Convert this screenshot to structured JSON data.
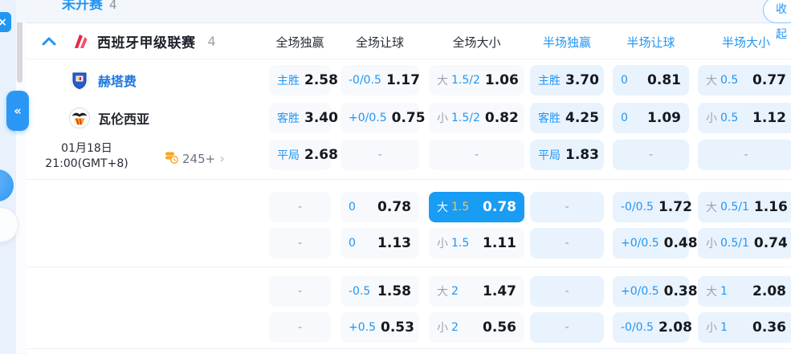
{
  "top_bar": {
    "status_label": "未开赛",
    "status_count": "4",
    "collapse_label": "收起"
  },
  "league": {
    "name": "西班牙甲级联赛",
    "count": "4"
  },
  "columns": [
    {
      "label": "全场独赢",
      "scope": "full"
    },
    {
      "label": "全场让球",
      "scope": "full"
    },
    {
      "label": "全场大小",
      "scope": "full"
    },
    {
      "label": "半场独赢",
      "scope": "half"
    },
    {
      "label": "半场让球",
      "scope": "half"
    },
    {
      "label": "半场大小",
      "scope": "half"
    }
  ],
  "match": {
    "home_team": "赫塔费",
    "away_team": "瓦伦西亚",
    "date": "01月18日",
    "time": "21:00(GMT+8)",
    "markets_count": "245+"
  },
  "glyphs": {
    "collapse_tab": "«",
    "close": "×",
    "chevron_right": "›",
    "dash": "-"
  },
  "colors": {
    "accent": "#2196f3",
    "selected_cell_bg": "#199cf4",
    "selected_handicap": "#f4c45a",
    "full_cell_bg": "#f7f9fc",
    "half_cell_bg": "#e9f3fd",
    "odds_text": "#16191f"
  },
  "odds_groups": [
    {
      "rows": [
        {
          "cells": [
            {
              "label": "主胜",
              "value": "2.58",
              "type": "full"
            },
            {
              "label": "-0/0.5",
              "value": "1.17",
              "type": "full"
            },
            {
              "prefix": "大",
              "label": "1.5/2",
              "value": "1.06",
              "type": "full"
            },
            {
              "label": "主胜",
              "value": "3.70",
              "type": "half"
            },
            {
              "label": "0",
              "value": "0.81",
              "type": "half"
            },
            {
              "prefix": "大",
              "label": "0.5",
              "value": "0.77",
              "type": "half"
            }
          ]
        },
        {
          "cells": [
            {
              "label": "客胜",
              "value": "3.40",
              "type": "full"
            },
            {
              "label": "+0/0.5",
              "value": "0.75",
              "type": "full"
            },
            {
              "prefix": "小",
              "label": "1.5/2",
              "value": "0.82",
              "type": "full"
            },
            {
              "label": "客胜",
              "value": "4.25",
              "type": "half"
            },
            {
              "label": "0",
              "value": "1.09",
              "type": "half"
            },
            {
              "prefix": "小",
              "label": "0.5",
              "value": "1.12",
              "type": "half"
            }
          ]
        },
        {
          "cells": [
            {
              "label": "平局",
              "value": "2.68",
              "type": "full"
            },
            {
              "dash": true,
              "type": "full"
            },
            {
              "dash": true,
              "type": "full"
            },
            {
              "label": "平局",
              "value": "1.83",
              "type": "half"
            },
            {
              "dash": true,
              "type": "half"
            },
            {
              "dash": true,
              "type": "half"
            }
          ]
        }
      ]
    },
    {
      "rows": [
        {
          "cells": [
            {
              "dash": true,
              "type": "full"
            },
            {
              "label": "0",
              "value": "0.78",
              "type": "full"
            },
            {
              "prefix": "大",
              "label": "1.5",
              "value": "0.78",
              "type": "full",
              "selected": true
            },
            {
              "dash": true,
              "type": "half"
            },
            {
              "label": "-0/0.5",
              "value": "1.72",
              "type": "half"
            },
            {
              "prefix": "大",
              "label": "0.5/1",
              "value": "1.16",
              "type": "half"
            }
          ]
        },
        {
          "cells": [
            {
              "dash": true,
              "type": "full"
            },
            {
              "label": "0",
              "value": "1.13",
              "type": "full"
            },
            {
              "prefix": "小",
              "label": "1.5",
              "value": "1.11",
              "type": "full"
            },
            {
              "dash": true,
              "type": "half"
            },
            {
              "label": "+0/0.5",
              "value": "0.48",
              "type": "half"
            },
            {
              "prefix": "小",
              "label": "0.5/1",
              "value": "0.74",
              "type": "half"
            }
          ]
        }
      ]
    },
    {
      "rows": [
        {
          "cells": [
            {
              "dash": true,
              "type": "full"
            },
            {
              "label": "-0.5",
              "value": "1.58",
              "type": "full"
            },
            {
              "prefix": "大",
              "label": "2",
              "value": "1.47",
              "type": "full"
            },
            {
              "dash": true,
              "type": "half"
            },
            {
              "label": "+0/0.5",
              "value": "0.38",
              "type": "half"
            },
            {
              "prefix": "大",
              "label": "1",
              "value": "2.08",
              "type": "half"
            }
          ]
        },
        {
          "cells": [
            {
              "dash": true,
              "type": "full"
            },
            {
              "label": "+0.5",
              "value": "0.53",
              "type": "full"
            },
            {
              "prefix": "小",
              "label": "2",
              "value": "0.56",
              "type": "full"
            },
            {
              "dash": true,
              "type": "half"
            },
            {
              "label": "-0/0.5",
              "value": "2.08",
              "type": "half"
            },
            {
              "prefix": "小",
              "label": "1",
              "value": "0.36",
              "type": "half"
            }
          ]
        }
      ]
    }
  ]
}
